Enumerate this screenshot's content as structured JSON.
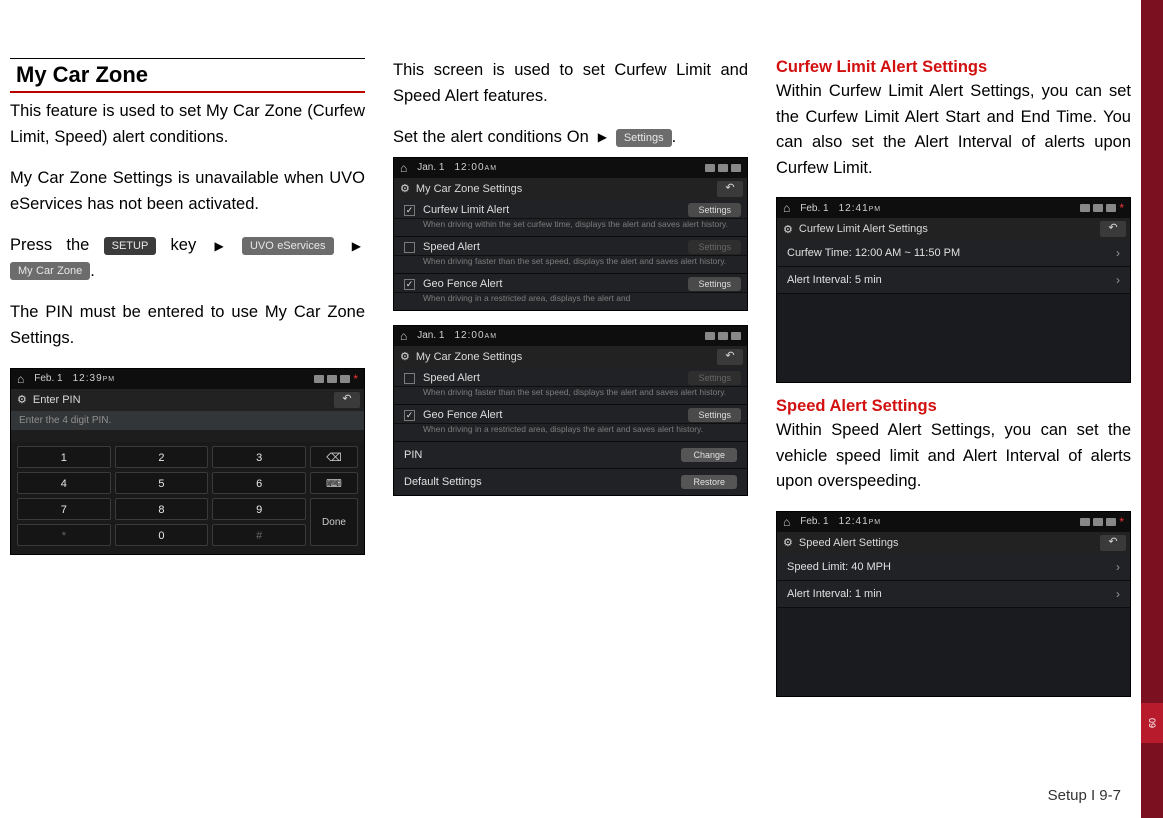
{
  "col1": {
    "section_title": "My Car Zone",
    "p1": "This feature is used to set My Car Zone (Curfew Limit, Speed) alert conditions.",
    "p2": "My Car Zone Settings is unavailable when UVO eServices has not been activated.",
    "p3a": "Press the ",
    "btn_setup": "SETUP",
    "p3b": " key ",
    "btn_uvo": "UVO eServices",
    "btn_myzone": "My Car Zone",
    "p4": "The PIN must be entered to use My Car Zone Settings.",
    "ss1": {
      "date": "Feb. 1",
      "time": "12:39",
      "ampm": "PM",
      "title": "Enter PIN",
      "placeholder": "Enter the 4 digit PIN.",
      "keys": [
        "1",
        "2",
        "3",
        "4",
        "5",
        "6",
        "7",
        "8",
        "9",
        "*",
        "0",
        "#"
      ],
      "backspace": "⌫",
      "keyboard": "⌨",
      "done": "Done"
    }
  },
  "col2": {
    "p1": "This screen is used to set Curfew Limit and Speed Alert features.",
    "p2a": "Set the alert conditions On ",
    "btn_settings": "Settings",
    "ss2": {
      "date": "Jan. 1",
      "time": "12:00",
      "ampm": "AM",
      "title": "My Car Zone Settings",
      "curfew_label": "Curfew Limit Alert",
      "curfew_desc": "When driving within the set curfew time, displays the alert and saves alert history.",
      "speed_label": "Speed Alert",
      "speed_desc": "When driving faster than the set speed, displays the alert and saves alert history.",
      "geo_label": "Geo Fence Alert",
      "geo_desc": "When driving in a restricted area, displays the alert and",
      "btn": "Settings"
    },
    "ss3": {
      "date": "Jan. 1",
      "time": "12:00",
      "ampm": "AM",
      "title": "My Car Zone Settings",
      "speed_label": "Speed Alert",
      "speed_desc": "When driving faster than the set speed, displays the alert and saves alert history.",
      "geo_label": "Geo Fence Alert",
      "geo_desc": "When driving in a restricted area, displays the alert and saves alert history.",
      "pin_label": "PIN",
      "pin_btn": "Change",
      "default_label": "Default Settings",
      "default_btn": "Restore",
      "settings_btn": "Settings"
    }
  },
  "col3": {
    "h1": "Curfew Limit Alert Settings",
    "p1": "Within Curfew Limit Alert Settings, you can set the Curfew Limit Alert Start and End Time. You can also set the Alert Interval of alerts upon Curfew Limit.",
    "ss4": {
      "date": "Feb. 1",
      "time": "12:41",
      "ampm": "PM",
      "title": "Curfew Limit Alert Settings",
      "row1": "Curfew Time: 12:00 AM ~ 11:50 PM",
      "row2": "Alert Interval: 5 min"
    },
    "h2": "Speed Alert Settings",
    "p2": "Within Speed Alert Settings, you can set the vehicle speed limit and Alert Interval of alerts upon overspeeding.",
    "ss5": {
      "date": "Feb. 1",
      "time": "12:41",
      "ampm": "PM",
      "title": "Speed Alert Settings",
      "row1": "Speed Limit: 40 MPH",
      "row2": "Alert Interval: 1 min"
    }
  },
  "page_num": "Setup I 9-7",
  "tab": "09"
}
